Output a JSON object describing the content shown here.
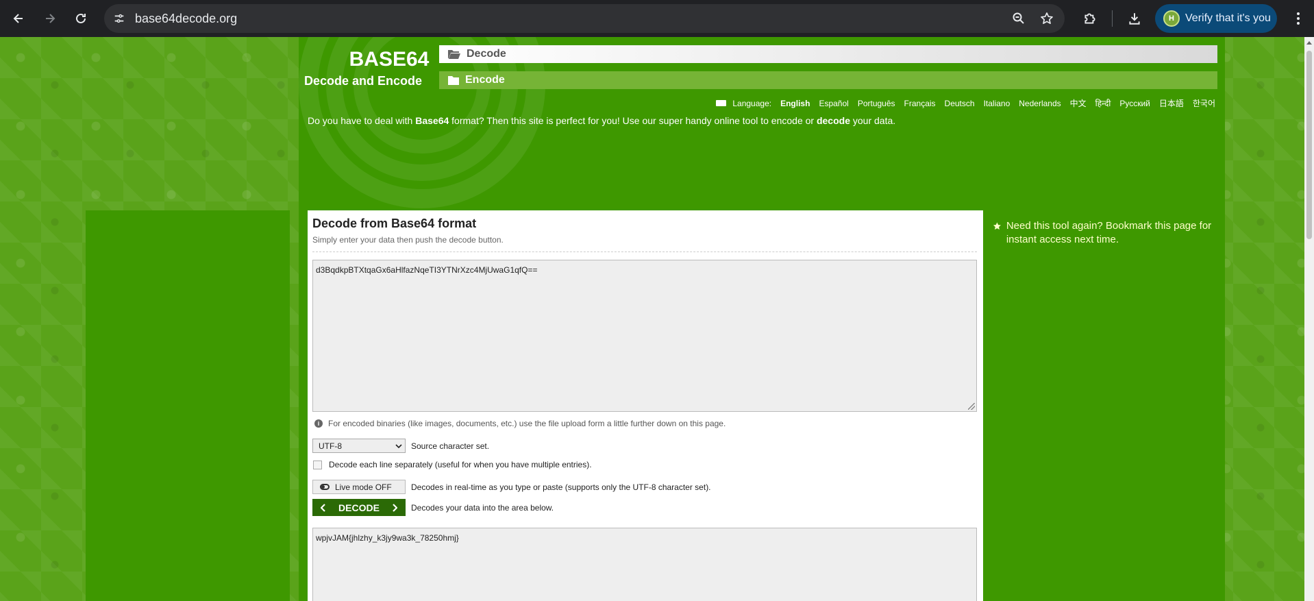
{
  "browser": {
    "url": "base64decode.org",
    "profile_button_label": "Verify that it's you",
    "profile_initial": "H"
  },
  "site": {
    "logo_title": "BASE64",
    "logo_subtitle": "Decode and Encode",
    "menu": {
      "decode_label": "Decode",
      "encode_label": "Encode"
    },
    "language_label": "Language:",
    "languages": [
      "English",
      "Español",
      "Português",
      "Français",
      "Deutsch",
      "Italiano",
      "Nederlands",
      "中文",
      "हिन्दी",
      "Русский",
      "日本語",
      "한국어"
    ],
    "intro": {
      "part1": "Do you have to deal with ",
      "bold1": "Base64",
      "part2": " format? Then this site is perfect for you! Use our super handy online tool to encode or ",
      "bold2": "decode",
      "part3": " your data."
    }
  },
  "decoder": {
    "title": "Decode from Base64 format",
    "subtitle": "Simply enter your data then push the decode button.",
    "input_value": "d3BqdkpBTXtqaGx6aHlfazNqeTI3YTNrXzc4MjUwaG1qfQ==",
    "binary_note": "For encoded binaries (like images, documents, etc.) use the file upload form a little further down on this page.",
    "charset_value": "UTF-8",
    "charset_label": "Source character set.",
    "each_line_label": "Decode each line separately (useful for when you have multiple entries).",
    "live_mode_label": "Live mode OFF",
    "live_mode_desc": "Decodes in real-time as you type or paste (supports only the UTF-8 character set).",
    "decode_button_label": "DECODE",
    "decode_desc": "Decodes your data into the area below.",
    "output_value": "wpjvJAM{jhlzhy_k3jy9wa3k_78250hmj}"
  },
  "sidebar": {
    "bookmark_note": "Need this tool again? Bookmark this page for instant access next time."
  },
  "colors": {
    "chrome_bg": "#202124",
    "site_green": "#3e9800",
    "decode_button": "#2b6a06",
    "note_text": "#ffffcc"
  }
}
